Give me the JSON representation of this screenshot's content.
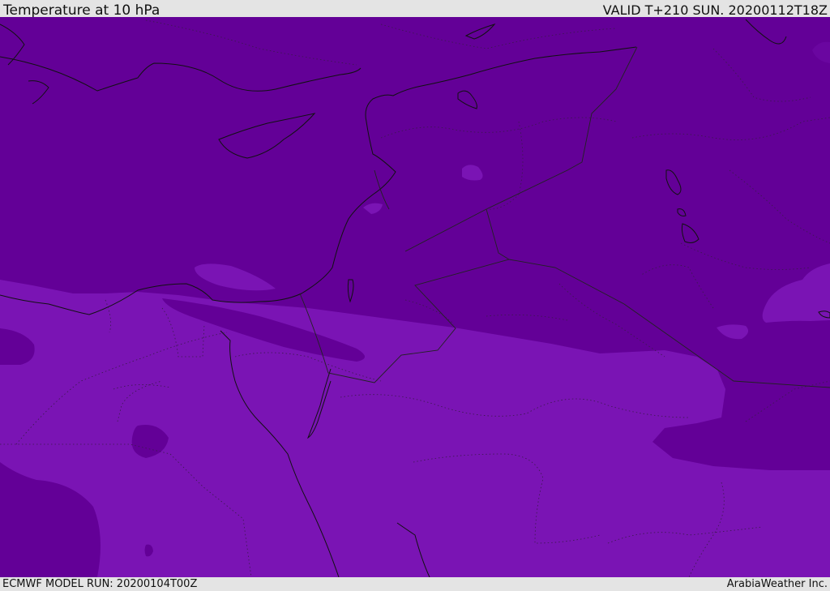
{
  "header": {
    "title": "Temperature at 10 hPa",
    "valid": "VALID T+210 SUN. 20200112T18Z"
  },
  "footer": {
    "model_run": "ECMWF MODEL RUN: 20200104T00Z",
    "credit": "ArabiaWeather Inc."
  },
  "map": {
    "region": "Eastern Mediterranean / Middle East",
    "colors": {
      "cold_fill": "#630097",
      "warm_fill": "#7a14b4",
      "coastline": "#111111",
      "border": "#222222"
    }
  }
}
